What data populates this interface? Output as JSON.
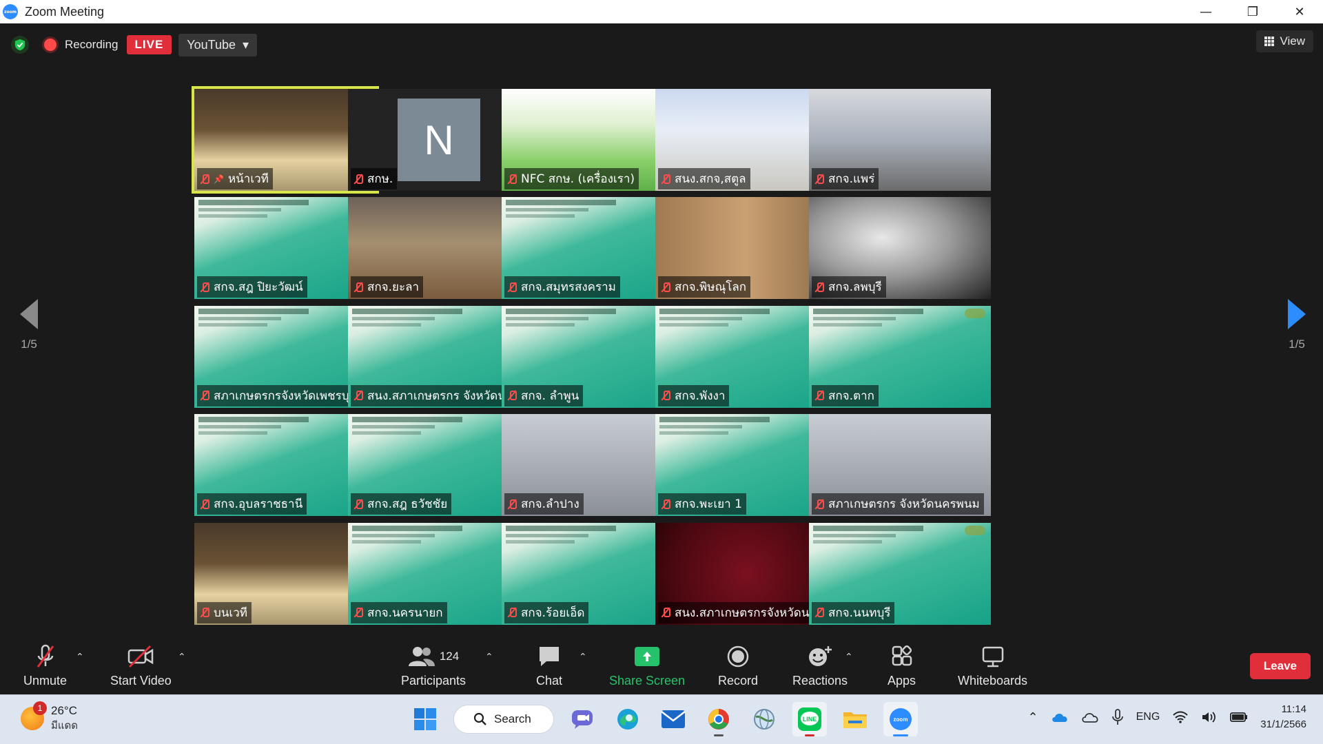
{
  "window": {
    "title": "Zoom Meeting",
    "minimize": "—",
    "restore": "❐",
    "close": "✕"
  },
  "topbar": {
    "recording_label": "Recording",
    "live_label": "LIVE",
    "stream_target": "YouTube",
    "view_label": "View"
  },
  "gallery": {
    "page_left": "1/5",
    "page_right": "1/5",
    "tiles": [
      {
        "name": "หน้าเวที",
        "bg": "bg-room",
        "pinned": true
      },
      {
        "name": "สกษ.",
        "bg": "avatar",
        "avatar": "N"
      },
      {
        "name": "NFC สกษ. (เครื่องเรา)",
        "bg": "bg-poster"
      },
      {
        "name": "สนง.สกจ,สตูล",
        "bg": "bg-banner"
      },
      {
        "name": "สกจ.แพร่",
        "bg": "bg-conf"
      },
      {
        "name": "สกจ.สฎ ปิยะวัฒน์",
        "bg": "bg-green"
      },
      {
        "name": "สกจ.ยะลา",
        "bg": "bg-office"
      },
      {
        "name": "สกจ.สมุทรสงคราม",
        "bg": "bg-green"
      },
      {
        "name": "สกจ.พิษณุโลก",
        "bg": "bg-wall"
      },
      {
        "name": "สกจ.ลพบุรี",
        "bg": "bg-blur"
      },
      {
        "name": "สภาเกษตรกรจังหวัดเพชรบุรี",
        "bg": "bg-green"
      },
      {
        "name": "สนง.สภาเกษตรกร จังหวัดนรา...",
        "bg": "bg-green"
      },
      {
        "name": "สกจ. ลำพูน",
        "bg": "bg-green"
      },
      {
        "name": "สกจ.พังงา",
        "bg": "bg-green"
      },
      {
        "name": "สกจ.ตาก",
        "bg": "bg-green"
      },
      {
        "name": "สกจ.อุบลราชธานี",
        "bg": "bg-green"
      },
      {
        "name": "สกจ.สฎ ธวัชชัย",
        "bg": "bg-green"
      },
      {
        "name": "สกจ.ลำปาง",
        "bg": "bg-dark"
      },
      {
        "name": "สกจ.พะเยา 1",
        "bg": "bg-green"
      },
      {
        "name": "สภาเกษตรกร จังหวัดนครพนม",
        "bg": "bg-dark"
      },
      {
        "name": "บนเวที",
        "bg": "bg-room"
      },
      {
        "name": "สกจ.นครนายก",
        "bg": "bg-green"
      },
      {
        "name": "สกจ.ร้อยเอ็ด",
        "bg": "bg-green"
      },
      {
        "name": "สนง.สภาเกษตรกรจังหวัดนคร...",
        "bg": "bg-red"
      },
      {
        "name": "สกจ.นนทบุรี",
        "bg": "bg-green"
      }
    ]
  },
  "toolbar": {
    "unmute": "Unmute",
    "start_video": "Start Video",
    "participants": "Participants",
    "participant_count": "124",
    "chat": "Chat",
    "share_screen": "Share Screen",
    "record": "Record",
    "reactions": "Reactions",
    "apps": "Apps",
    "whiteboards": "Whiteboards",
    "leave": "Leave"
  },
  "taskbar": {
    "weather_temp": "26°C",
    "weather_desc": "มีแดด",
    "weather_badge": "1",
    "search_label": "Search",
    "zoom_label": "zoom",
    "line_label": "LINE",
    "lang": "ENG",
    "time": "11:14",
    "date": "31/1/2566"
  },
  "colors": {
    "accent": "#2d8cff",
    "live": "#e02e3a",
    "share": "#25c26b",
    "active_speaker": "#d8e548"
  }
}
